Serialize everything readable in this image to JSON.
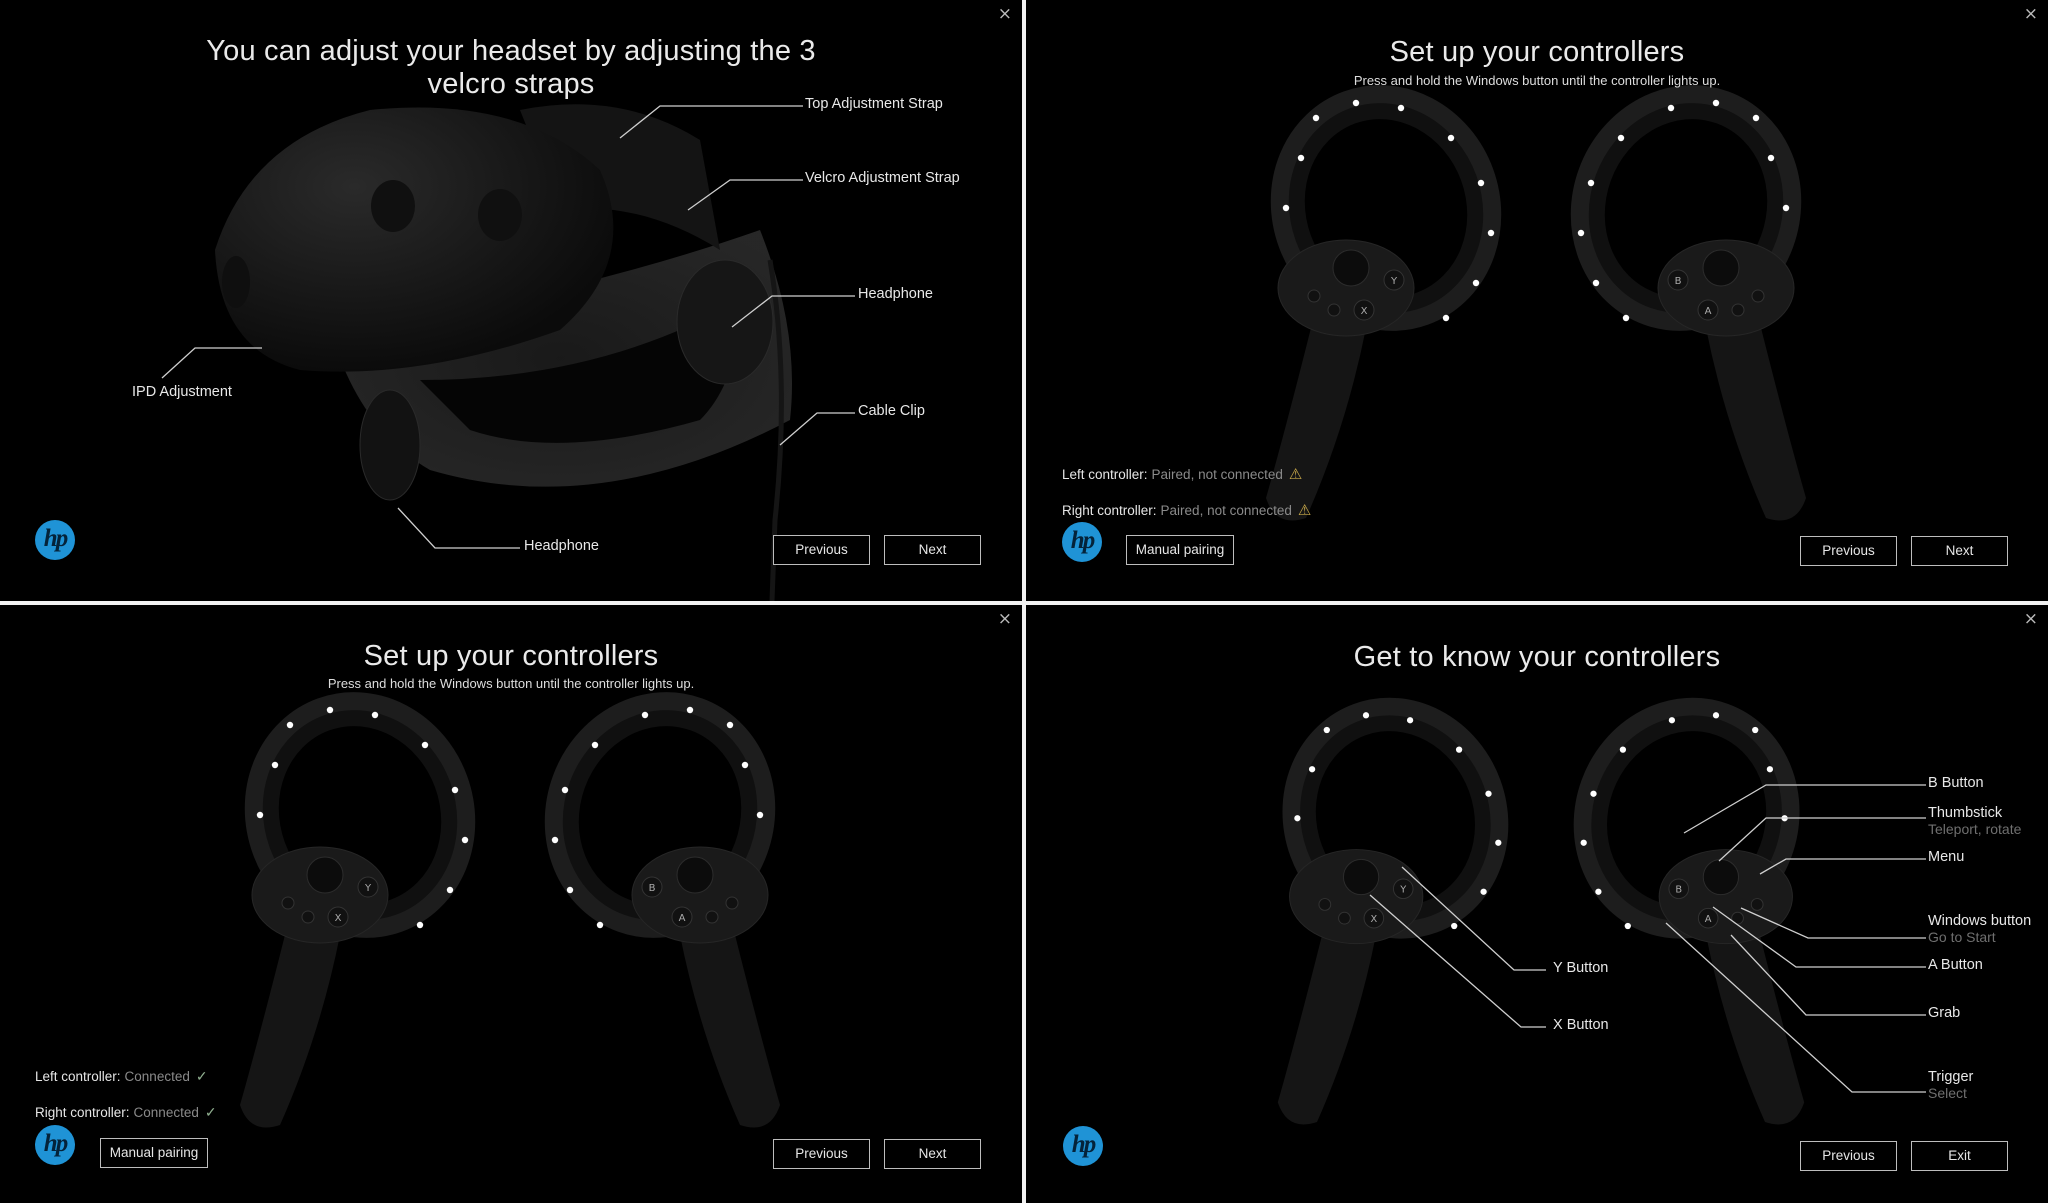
{
  "close_label": "×",
  "logo": {
    "text": "hp",
    "color": "#1f93d6"
  },
  "panels": [
    {
      "title_line1": "You can adjust your headset by adjusting the 3",
      "title_line2": "velcro straps",
      "callouts": {
        "top_strap": "Top Adjustment Strap",
        "velcro_strap": "Velcro Adjustment Strap",
        "headphone_right": "Headphone",
        "cable_clip": "Cable Clip",
        "ipd": "IPD Adjustment",
        "headphone_bottom": "Headphone"
      },
      "buttons": {
        "previous": "Previous",
        "next": "Next"
      }
    },
    {
      "title": "Set up your controllers",
      "subtitle": "Press and hold the Windows button until the controller lights up.",
      "status": {
        "left_label": "Left controller:",
        "left_value": "Paired, not connected",
        "left_icon": "warning-icon",
        "right_label": "Right controller:",
        "right_value": "Paired, not connected",
        "right_icon": "warning-icon"
      },
      "buttons": {
        "manual": "Manual pairing",
        "previous": "Previous",
        "next": "Next"
      }
    },
    {
      "title": "Set up your controllers",
      "subtitle": "Press and hold the Windows button until the controller lights up.",
      "status": {
        "left_label": "Left controller:",
        "left_value": "Connected",
        "left_icon": "checkmark-icon",
        "right_label": "Right controller:",
        "right_value": "Connected",
        "right_icon": "checkmark-icon"
      },
      "buttons": {
        "manual": "Manual pairing",
        "previous": "Previous",
        "next": "Next"
      }
    },
    {
      "title": "Get to know your controllers",
      "callouts": {
        "b_button": "B Button",
        "thumbstick": "Thumbstick",
        "thumbstick_sub": "Teleport, rotate",
        "menu": "Menu",
        "windows": "Windows button",
        "windows_sub": "Go to Start",
        "a_button": "A Button",
        "grab": "Grab",
        "trigger": "Trigger",
        "trigger_sub": "Select",
        "y_button": "Y Button",
        "x_button": "X Button"
      },
      "buttons": {
        "previous": "Previous",
        "exit": "Exit"
      }
    }
  ],
  "glyphs": {
    "warning": "⚠",
    "check": "✓",
    "x": "X",
    "y": "Y",
    "a": "A",
    "b": "B"
  }
}
